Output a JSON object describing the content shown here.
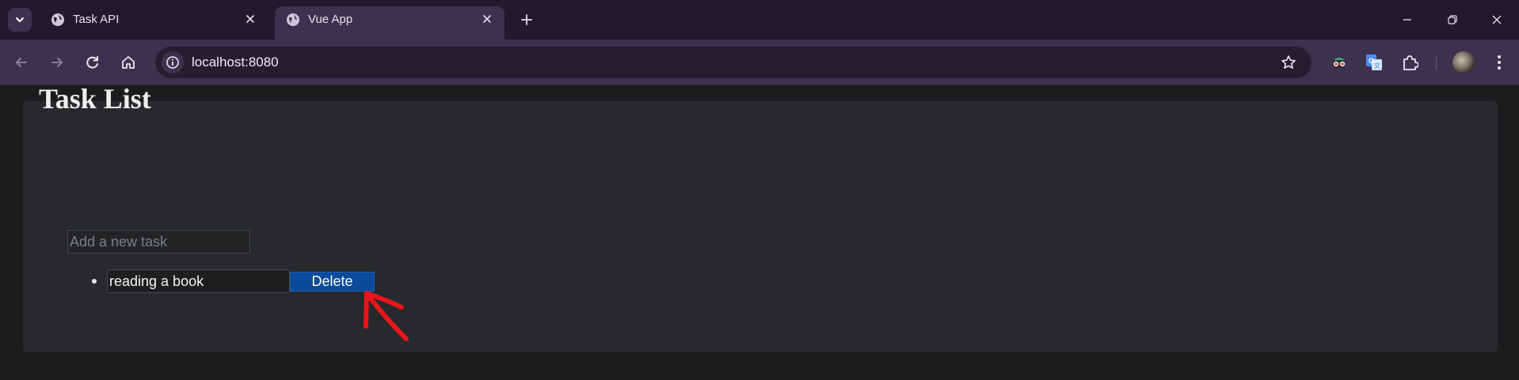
{
  "browser": {
    "tabs": [
      {
        "title": "Task API",
        "active": false
      },
      {
        "title": "Vue App",
        "active": true
      }
    ],
    "url": "localhost:8080",
    "icons": {
      "tab_search": "chevron-down-icon",
      "favicon": "globe-icon",
      "tab_close": "close-icon",
      "new_tab": "plus-icon",
      "minimize": "minimize-icon",
      "restore": "restore-icon",
      "close_window": "close-icon",
      "back": "back-arrow-icon",
      "forward": "forward-arrow-icon",
      "reload": "reload-icon",
      "home": "home-icon",
      "site_info": "info-icon",
      "bookmark": "star-icon",
      "extensions": [
        "spy-glasses-icon",
        "translate-icon",
        "puzzle-icon"
      ],
      "menu": "more-vertical-icon"
    }
  },
  "app": {
    "heading": "Task List",
    "new_task_placeholder": "Add a new task",
    "tasks": [
      {
        "text": "reading a book",
        "delete_label": "Delete"
      }
    ]
  },
  "colors": {
    "tabstrip": "#23192e",
    "toolbar": "#3d3150",
    "page_bg": "#1b1c1e",
    "card_bg": "#27292c",
    "delete_button": "#0a4a9a",
    "annotation_arrow": "#e8161c"
  }
}
